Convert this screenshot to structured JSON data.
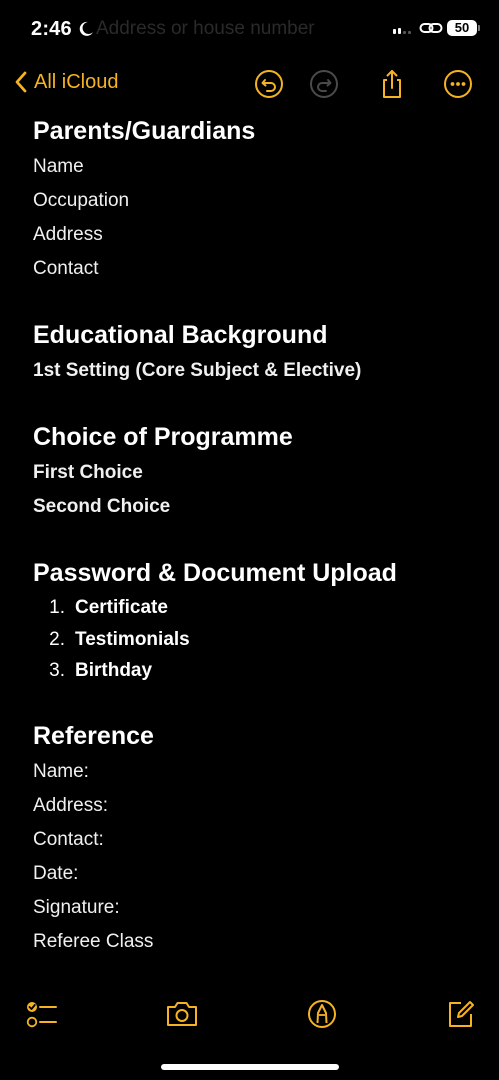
{
  "status_bar": {
    "time": "2:46",
    "battery": "50",
    "background_text": "Address or house number"
  },
  "nav": {
    "back_label": "All iCloud",
    "accent_color": "#f5b324",
    "icons": [
      "chevron-left-icon",
      "undo-icon",
      "redo-icon",
      "share-icon",
      "more-icon"
    ]
  },
  "note": {
    "sections": [
      {
        "heading": "Parents/Guardians",
        "lines": [
          "Name",
          "Occupation",
          "Address",
          "Contact"
        ]
      },
      {
        "heading": "Educational Background",
        "lines": [
          "1st Setting (Core Subject & Elective)"
        ]
      },
      {
        "heading": "Choice of Programme",
        "lines": [
          "First Choice",
          "Second Choice"
        ]
      },
      {
        "heading": "Password & Document Upload",
        "list": [
          "Certificate",
          "Testimonials",
          "Birthday"
        ]
      },
      {
        "heading": "Reference",
        "lines": [
          "Name:",
          "Address:",
          "Contact:",
          "Date:",
          "Signature:",
          "Referee Class"
        ]
      }
    ]
  },
  "toolbar": {
    "icons": [
      "checklist-icon",
      "camera-icon",
      "markup-pen-icon",
      "compose-icon"
    ]
  }
}
